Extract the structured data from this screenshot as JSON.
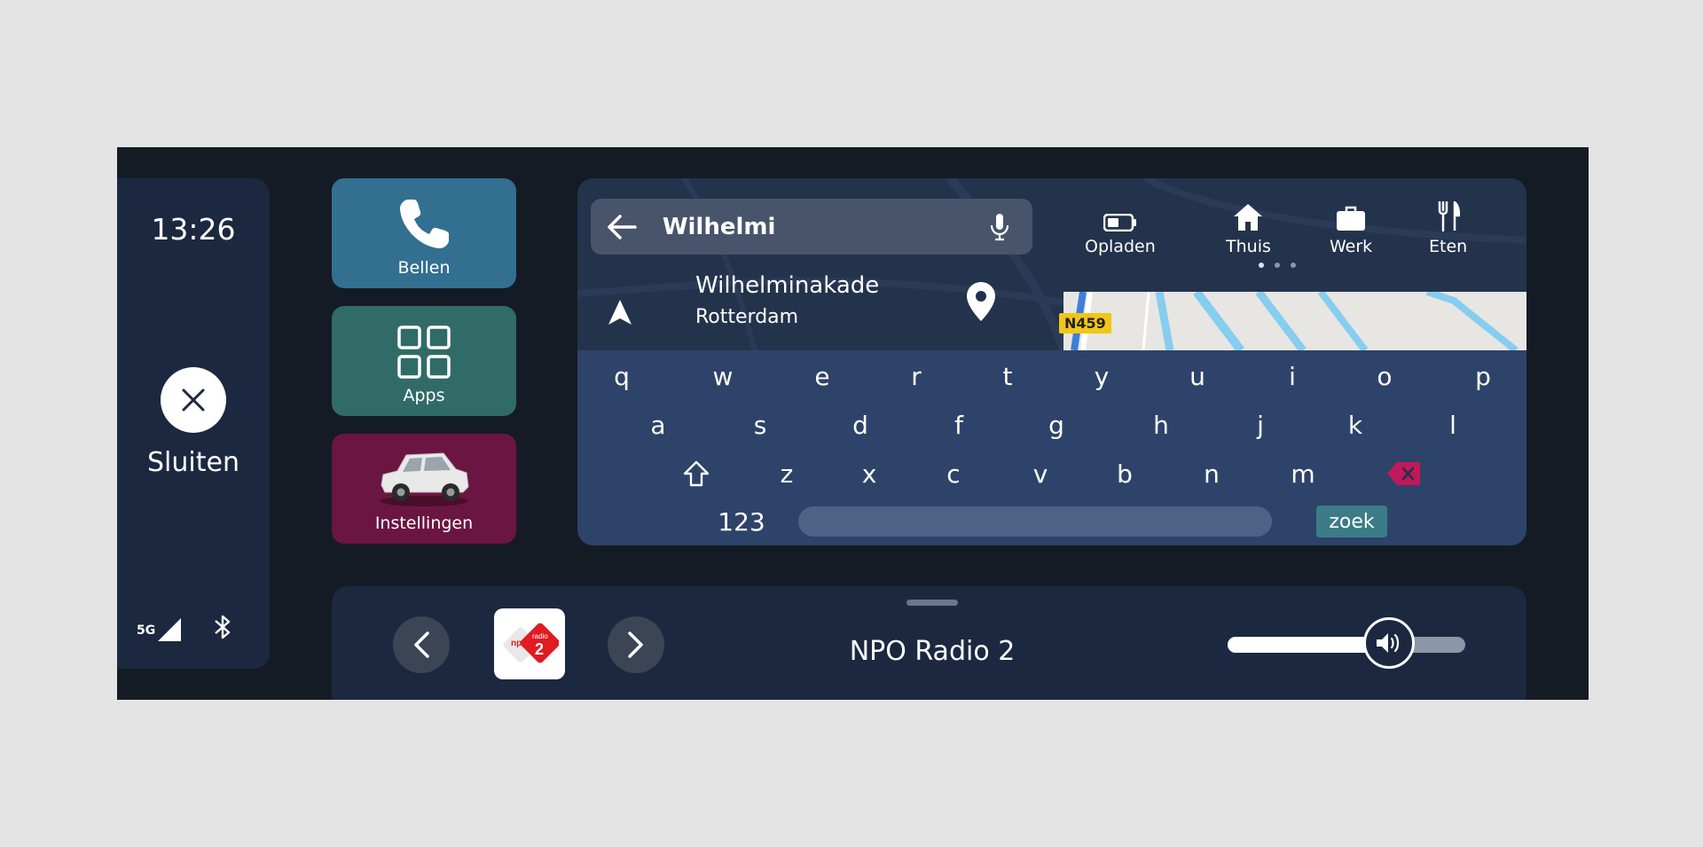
{
  "status": {
    "time": "13:26",
    "close_label": "Sluiten",
    "network": "5G",
    "icons": [
      "close-icon",
      "signal-icon",
      "bluetooth-icon"
    ]
  },
  "tiles": [
    {
      "label": "Bellen",
      "icon": "phone-icon",
      "color": "#336f91"
    },
    {
      "label": "Apps",
      "icon": "apps-grid-icon",
      "color": "#316b67"
    },
    {
      "label": "Instellingen",
      "icon": "car-icon",
      "color": "#6b1542"
    }
  ],
  "search": {
    "value": "Wilhelmi",
    "icons": [
      "back-arrow-icon",
      "microphone-icon"
    ]
  },
  "result": {
    "name": "Wilhelminakade",
    "city": "Rotterdam",
    "icons": [
      "navigation-arrow-icon",
      "location-pin-icon"
    ]
  },
  "map": {
    "road_label": "N459"
  },
  "quick_destinations": [
    {
      "label": "Opladen",
      "icon": "battery-icon"
    },
    {
      "label": "Thuis",
      "icon": "home-icon"
    },
    {
      "label": "Werk",
      "icon": "briefcase-icon"
    },
    {
      "label": "Eten",
      "icon": "fork-knife-icon"
    }
  ],
  "pager": {
    "pages": 3,
    "current": 1
  },
  "keyboard": {
    "rows": [
      [
        "q",
        "w",
        "e",
        "r",
        "t",
        "y",
        "u",
        "i",
        "o",
        "p"
      ],
      [
        "a",
        "s",
        "d",
        "f",
        "g",
        "h",
        "j",
        "k",
        "l"
      ],
      [
        "z",
        "x",
        "c",
        "v",
        "b",
        "n",
        "m"
      ]
    ],
    "numbers_key": "123",
    "search_key": "zoek",
    "icons": [
      "shift-icon",
      "backspace-icon"
    ]
  },
  "media": {
    "station": "NPO Radio 2",
    "logo_text": "npo radio 2",
    "volume": 0.68,
    "icons": [
      "chevron-left-icon",
      "chevron-right-icon",
      "volume-icon"
    ]
  },
  "colors": {
    "screen_bg": "#151b24",
    "panel_bg": "#1c2840",
    "keyboard_bg": "#2e4369",
    "accent_search": "#3b7c86",
    "backspace": "#c2185b"
  }
}
